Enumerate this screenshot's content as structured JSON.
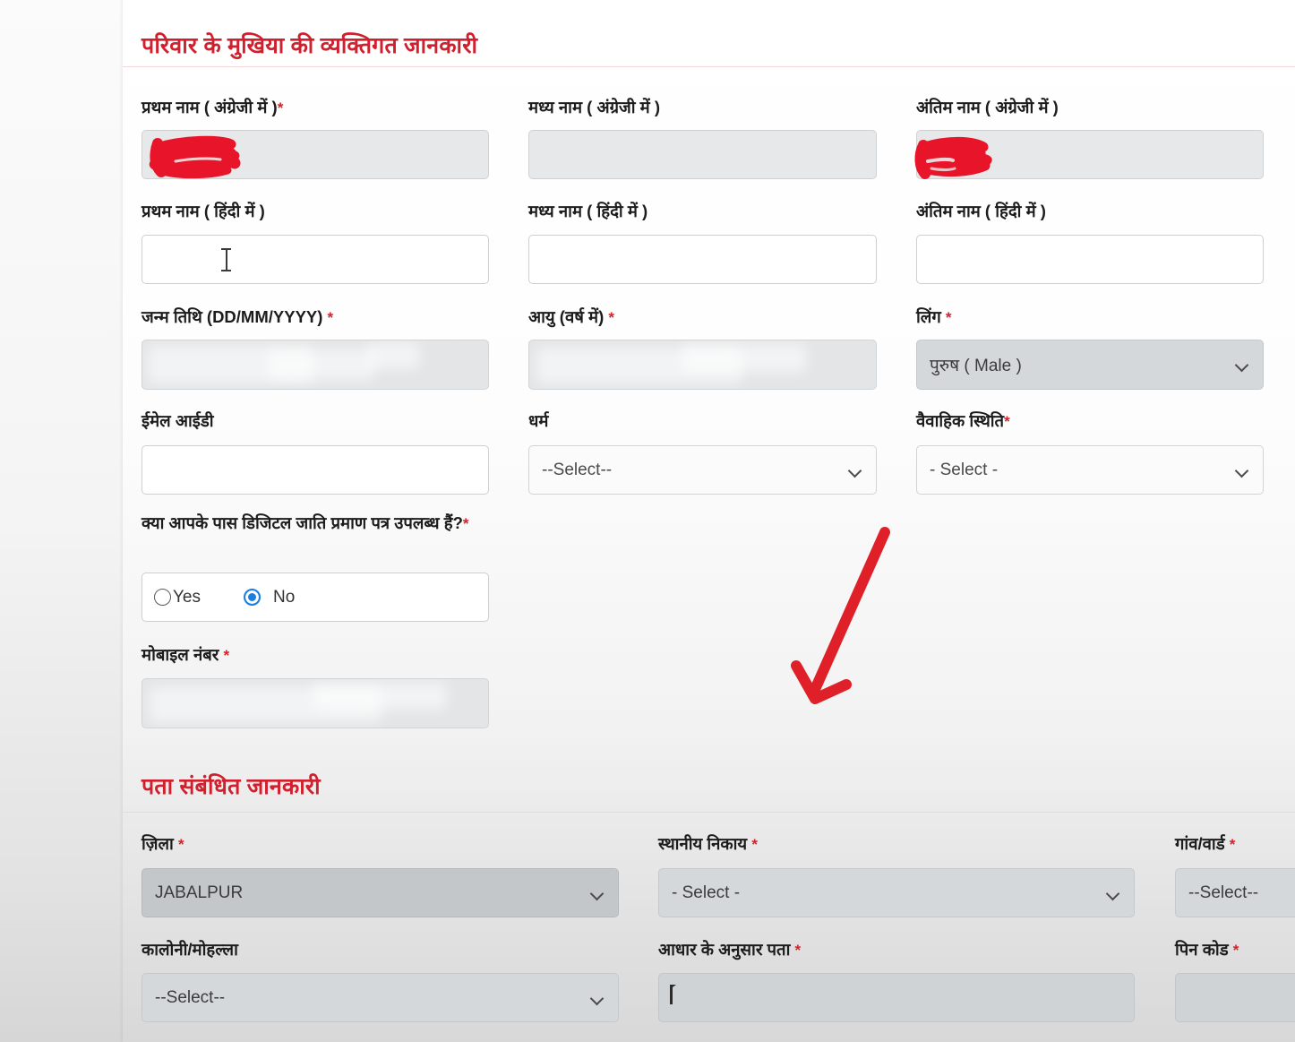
{
  "sections": {
    "personal": {
      "title": "परिवार के मुखिया की व्यक्तिगत जानकारी"
    },
    "address": {
      "title": "पता संबंधित जानकारी"
    }
  },
  "personal_fields": {
    "first_name_en": {
      "label": "प्रथम नाम ( अंग्रेजी में )",
      "required": "*",
      "value": ""
    },
    "middle_name_en": {
      "label": "मध्य नाम ( अंग्रेजी में )",
      "value": ""
    },
    "last_name_en": {
      "label": "अंतिम नाम ( अंग्रेजी में )",
      "value": ""
    },
    "first_name_hi": {
      "label": "प्रथम नाम ( हिंदी में )",
      "value": ""
    },
    "middle_name_hi": {
      "label": "मध्य नाम ( हिंदी में )",
      "value": ""
    },
    "last_name_hi": {
      "label": "अंतिम नाम ( हिंदी में )",
      "value": ""
    },
    "dob": {
      "label": "जन्म तिथि (DD/MM/YYYY)",
      "required": "*",
      "value": ""
    },
    "age": {
      "label": "आयु (वर्ष में)",
      "required": "*",
      "value": ""
    },
    "gender": {
      "label": "लिंग",
      "required": "*",
      "value": "पुरुष ( Male )"
    },
    "email": {
      "label": "ईमेल आईडी",
      "value": ""
    },
    "religion": {
      "label": "धर्म",
      "value": "--Select--"
    },
    "marital_status": {
      "label": "वैवाहिक स्थिति",
      "required": "*",
      "value": "- Select -"
    },
    "caste_certificate": {
      "label": "क्या आपके पास डिजिटल जाति प्रमाण पत्र उपलब्ध हैं?",
      "required": "*",
      "options": [
        {
          "label": "Yes",
          "selected": false
        },
        {
          "label": "No",
          "selected": true
        }
      ]
    },
    "mobile": {
      "label": "मोबाइल नंबर",
      "required": "*",
      "value": ""
    }
  },
  "address_fields": {
    "district": {
      "label": "ज़िला",
      "required": "*",
      "value": "JABALPUR"
    },
    "local_body": {
      "label": "स्थानीय निकाय",
      "required": "*",
      "value": "- Select -"
    },
    "village_ward": {
      "label": "गांव/वार्ड",
      "required": "*",
      "value": "--Select--"
    },
    "colony": {
      "label": "कालोनी/मोहल्ला",
      "value": "--Select--"
    },
    "aadhaar_address": {
      "label": "आधार के अनुसार पता",
      "required": "*",
      "value": ""
    },
    "pincode": {
      "label": "पिन कोड",
      "required": "*",
      "value": ""
    }
  },
  "annotations": {
    "arrow": {
      "name": "red-down-left-arrow",
      "color": "#e02029"
    },
    "scribble_first_name": {
      "name": "red-scribble-redaction",
      "color": "#e8152a"
    },
    "scribble_last_name": {
      "name": "red-scribble-redaction",
      "color": "#e8152a"
    }
  },
  "colors": {
    "heading": "#d0202e",
    "required": "#d8202c",
    "radio_selected": "#1b7fe0"
  }
}
